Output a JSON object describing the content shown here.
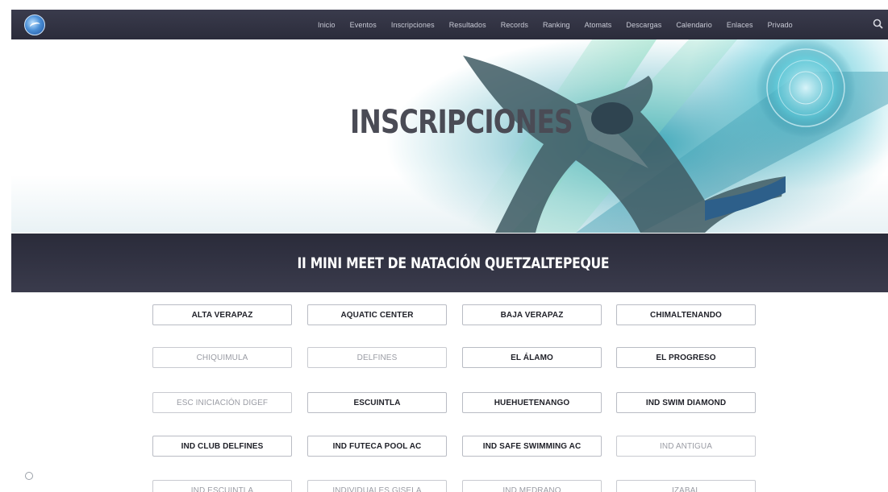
{
  "nav": {
    "items": [
      "Inicio",
      "Eventos",
      "Inscripciones",
      "Resultados",
      "Records",
      "Ranking",
      "Atomats",
      "Descargas",
      "Calendario",
      "Enlaces",
      "Privado"
    ]
  },
  "hero": {
    "title": "INSCRIPCIONES"
  },
  "event": {
    "title": "II MINI MEET DE NATACIÓN QUETZALTEPEQUE"
  },
  "clubs": [
    {
      "label": "ALTA VERAPAZ",
      "active": true
    },
    {
      "label": "AQUATIC CENTER",
      "active": true
    },
    {
      "label": "BAJA VERAPAZ",
      "active": true
    },
    {
      "label": "CHIMALTENANDO",
      "active": true
    },
    {
      "label": "CHIQUIMULA",
      "active": false
    },
    {
      "label": "DELFINES",
      "active": false
    },
    {
      "label": "EL ÁLAMO",
      "active": true
    },
    {
      "label": "EL PROGRESO",
      "active": true
    },
    {
      "label": "ESC INICIACIÓN DIGEF",
      "active": false
    },
    {
      "label": "ESCUINTLA",
      "active": true
    },
    {
      "label": "HUEHUETENANGO",
      "active": true
    },
    {
      "label": "IND SWIM DIAMOND",
      "active": true
    },
    {
      "label": "IND CLUB DELFINES",
      "active": true
    },
    {
      "label": "IND FUTECA POOL AC",
      "active": true
    },
    {
      "label": "IND SAFE SWIMMING AC",
      "active": true
    },
    {
      "label": "IND ANTIGUA",
      "active": false
    },
    {
      "label": "IND ESCUINTLA",
      "active": false
    },
    {
      "label": "INDIVIDUALES GISELA",
      "active": false
    },
    {
      "label": "IND MEDRANO",
      "active": false
    },
    {
      "label": "IZABAL",
      "active": false
    }
  ],
  "icons": {
    "logo": "swimming-federation-logo",
    "search": "search-icon"
  },
  "colors": {
    "nav_bg": "#2f3040",
    "band_bg": "#2f3040",
    "hero_accent": "#3ba6b8"
  }
}
